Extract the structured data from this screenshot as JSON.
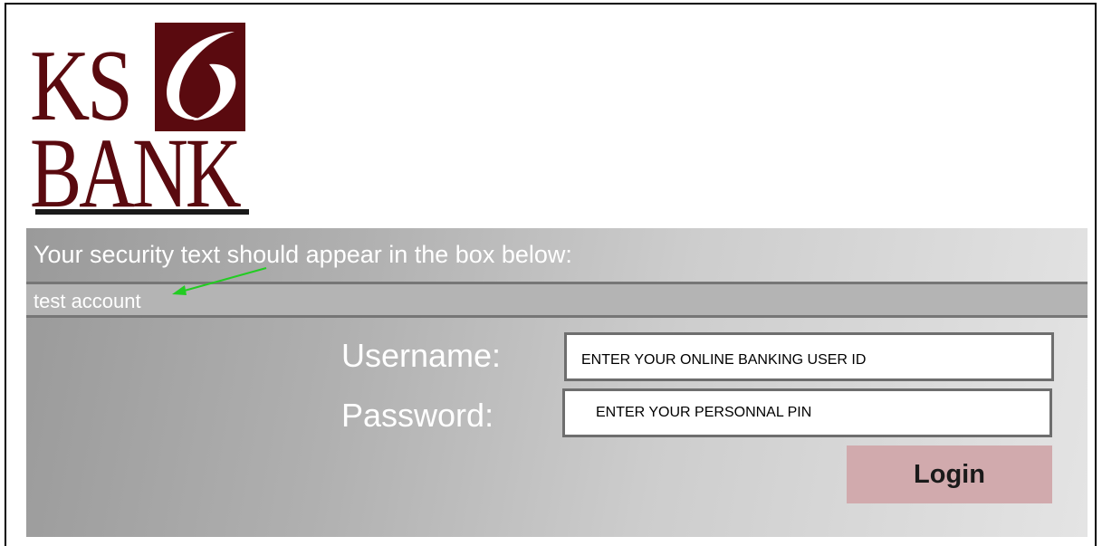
{
  "brand": {
    "logo_line1": "KS",
    "logo_line2": "BANK",
    "primary_color": "#5a0a0f"
  },
  "security": {
    "heading": "Your security text should appear in the box below:",
    "value": "test account",
    "arrow_color": "#22cc22"
  },
  "login_form": {
    "username_label": "Username:",
    "username_value": "ENTER YOUR ONLINE BANKING USER ID",
    "password_label": "Password:",
    "password_value": "ENTER YOUR PERSONNAL PIN",
    "login_label": "Login",
    "login_button_color": "#d1aaad"
  }
}
